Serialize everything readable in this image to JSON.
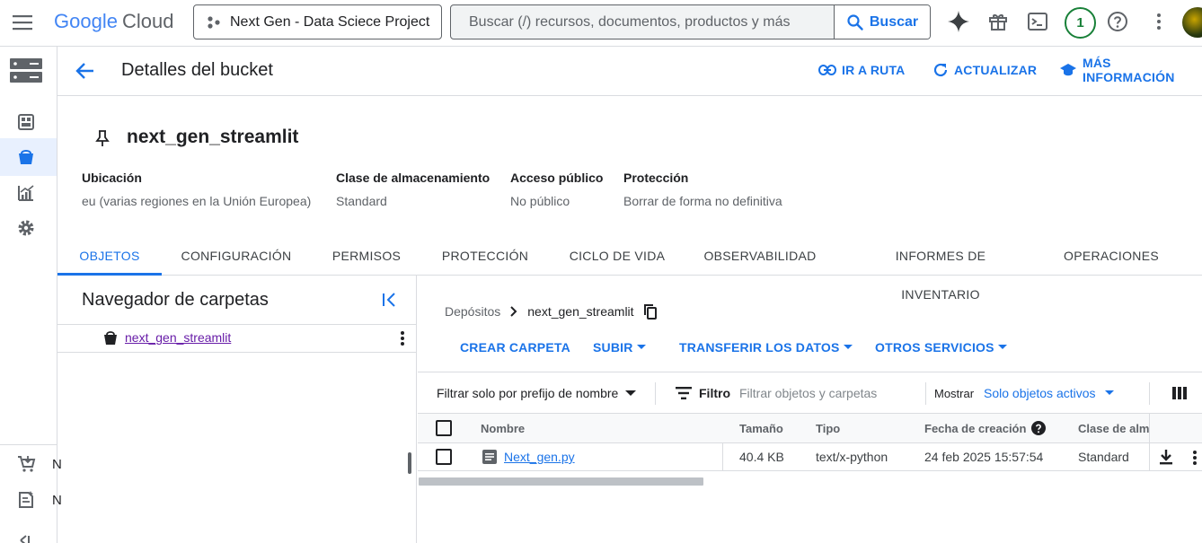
{
  "topbar": {
    "logo_google": "Google",
    "logo_cloud": "Cloud",
    "project": "Next Gen - Data Sciece Project",
    "search_placeholder": "Buscar (/) recursos, documentos, productos y más",
    "search_button": "Buscar",
    "notification_count": "1"
  },
  "header": {
    "title": "Detalles del bucket",
    "actions": [
      "IR A RUTA",
      "ACTUALIZAR",
      "MÁS INFORMACIÓN"
    ]
  },
  "bucket": {
    "name": "next_gen_streamlit",
    "meta": [
      {
        "label": "Ubicación",
        "value": "eu (varias regiones en la Unión Europea)"
      },
      {
        "label": "Clase de almacenamiento",
        "value": "Standard"
      },
      {
        "label": "Acceso público",
        "value": "No público"
      },
      {
        "label": "Protección",
        "value": "Borrar de forma no definitiva"
      }
    ]
  },
  "tabs": [
    "OBJETOS",
    "CONFIGURACIÓN",
    "PERMISOS",
    "PROTECCIÓN",
    "CICLO DE VIDA",
    "OBSERVABILIDAD",
    "INFORMES DE INVENTARIO",
    "OPERACIONES"
  ],
  "folder_nav": {
    "title": "Navegador de carpetas",
    "item": "next_gen_streamlit"
  },
  "breadcrumb": {
    "root": "Depósitos",
    "current": "next_gen_streamlit"
  },
  "commands": [
    "CREAR CARPETA",
    "SUBIR",
    "TRANSFERIR LOS DATOS",
    "OTROS SERVICIOS"
  ],
  "filter": {
    "prefix_label": "Filtrar solo por prefijo de nombre",
    "filter_label": "Filtro",
    "filter_placeholder": "Filtrar objetos y carpetas",
    "show_label": "Mostrar",
    "show_value": "Solo objetos activos"
  },
  "table": {
    "columns": [
      "Nombre",
      "Tamaño",
      "Tipo",
      "Fecha de creación",
      "Clase de alma"
    ],
    "rows": [
      {
        "name": "Next_gen.py",
        "size": "40.4 KB",
        "type": "text/x-python",
        "created": "24 feb 2025 15:57:54",
        "class": "Standard"
      }
    ]
  },
  "rail": {
    "bottom_letters": [
      "N",
      "N"
    ]
  },
  "colors": {
    "accent": "#1a73e8",
    "link_visited": "#681da8",
    "avatar_ring": "#188038"
  }
}
